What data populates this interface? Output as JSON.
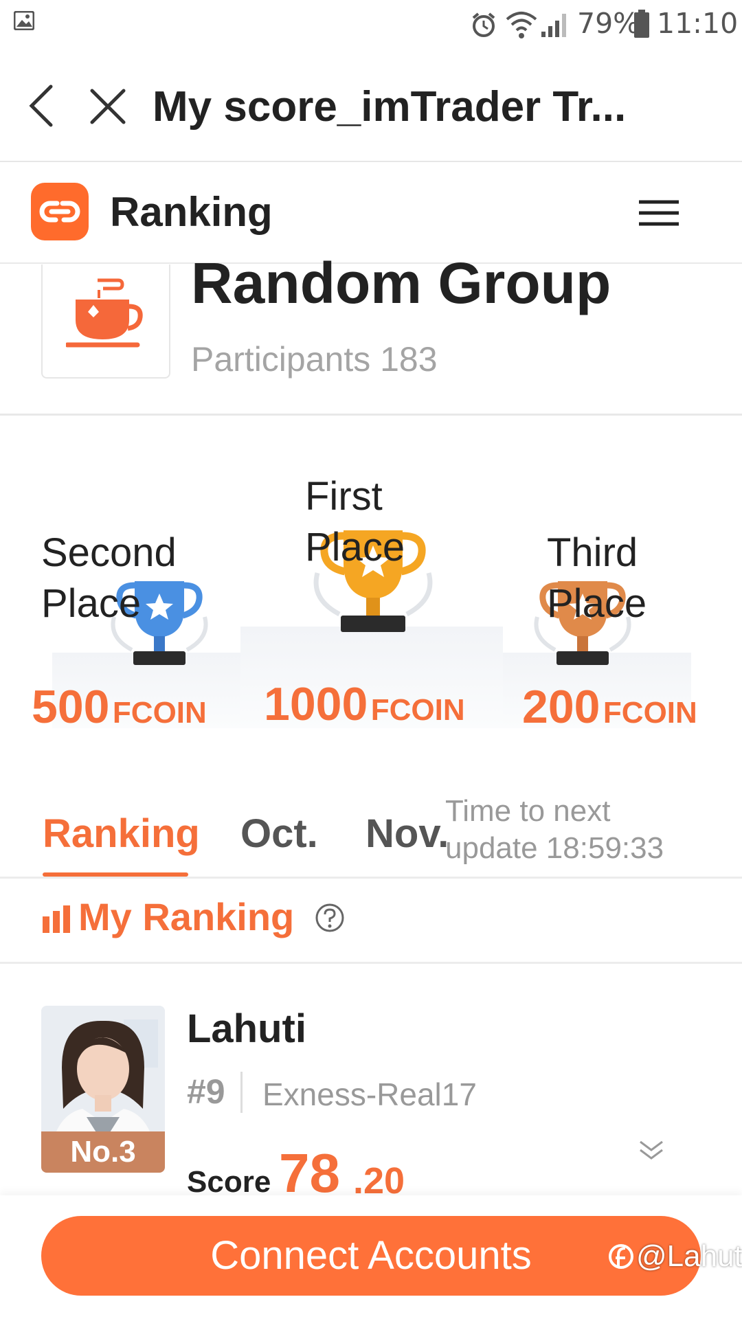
{
  "status_bar": {
    "battery": "79%",
    "time": "11:10"
  },
  "nav": {
    "title": "My score_imTrader Tr..."
  },
  "header": {
    "title": "Ranking"
  },
  "group": {
    "name": "Random Group",
    "participants": "Participants 183"
  },
  "prizes": {
    "second": {
      "label_line1": "Second",
      "label_line2": "Place",
      "amount": "500",
      "unit": "FCOIN"
    },
    "first": {
      "label_line1": "First",
      "label_line2": "Place",
      "amount": "1000",
      "unit": "FCOIN"
    },
    "third": {
      "label_line1": "Third",
      "label_line2": "Place",
      "amount": "200",
      "unit": "FCOIN"
    }
  },
  "tabs": [
    {
      "label": "Ranking",
      "active": true
    },
    {
      "label": "Oct.",
      "active": false
    },
    {
      "label": "Nov.",
      "active": false
    }
  ],
  "update": {
    "line1": "Time to next",
    "line2": "update 18:59:33"
  },
  "my_ranking": {
    "title": "My Ranking",
    "help_icon": "help-circle-icon"
  },
  "user": {
    "name": "Lahuti",
    "badge": "No.3",
    "rank": "#9",
    "account": "Exness-Real17",
    "score_label": "Score",
    "score_int": "78",
    "score_dec": ".20"
  },
  "cta": {
    "label": "Connect Accounts"
  },
  "watermark": "@Lahuti",
  "colors": {
    "accent": "#f56f3a",
    "gold": "#f5a623",
    "silver_blue": "#4a90e2",
    "bronze": "#e08a4a"
  }
}
